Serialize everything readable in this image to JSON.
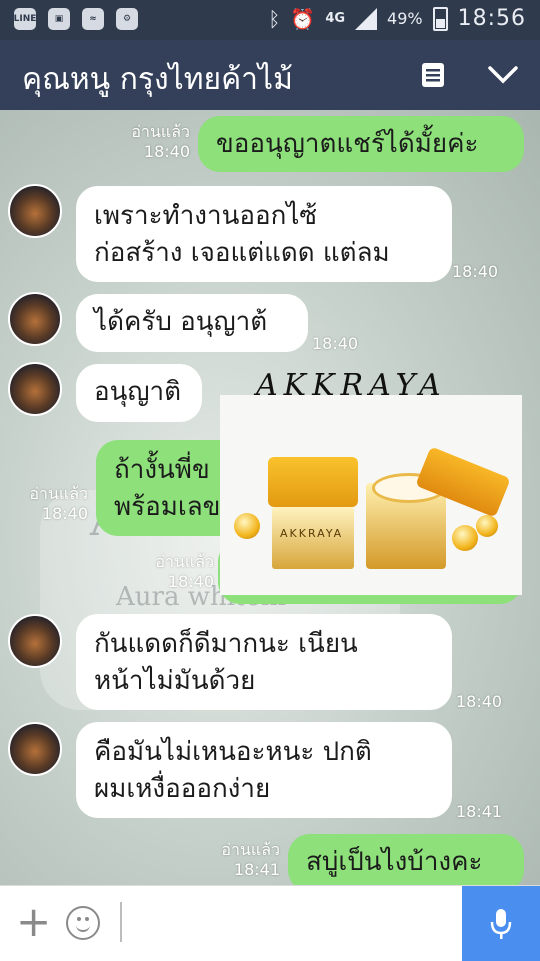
{
  "status_bar": {
    "icons_left": [
      "line-app-icon",
      "image-icon",
      "wifi-icon",
      "alarm-settings-icon"
    ],
    "line_label": "LINE",
    "network": "4G",
    "battery": "49%",
    "time": "18:56"
  },
  "header": {
    "title": "คุณหนู กรุงไทยค้าไม้"
  },
  "messages": [
    {
      "side": "out",
      "read": "อ่านแล้ว",
      "time": "18:40",
      "text": "ขออนุญาตแชร์ได้มั้ยค่ะ"
    },
    {
      "side": "in",
      "time": "18:40",
      "text": "เพราะทำงานออกไซ้\nก่อสร้าง เจอแต่แดด แต่ลม"
    },
    {
      "side": "in",
      "time": "18:40",
      "text": "ได้ครับ อนุญาต้"
    },
    {
      "side": "in",
      "time": "",
      "text": "อนุญาติ"
    },
    {
      "side": "out",
      "read": "อ่านแล้ว",
      "time": "18:40",
      "text": "ถ้างั้นพี่ข\nพร้อมเลข"
    },
    {
      "side": "out",
      "read": "อ่านแล้ว",
      "time": "18:40",
      "text": ""
    },
    {
      "side": "in",
      "time": "18:40",
      "text": "กันแดดก็ดีมากนะ เนียน\nหน้าไม่มันด้วย"
    },
    {
      "side": "in",
      "time": "18:41",
      "text": "คือมันไม่เหนอะหนะ ปกติ\nผมเหงื่อออกง่าย"
    },
    {
      "side": "out",
      "read": "อ่านแล้ว",
      "time": "18:41",
      "text": "สบู่เป็นไงบ้างคะ"
    }
  ],
  "background_text": {
    "brand": "AKKR",
    "product": "Aura whiteni"
  },
  "product_image": {
    "signature": "AKKRAYA",
    "jar_label": "AKKRAYA"
  },
  "input": {
    "placeholder": ""
  },
  "colors": {
    "outgoing": "#8de07a",
    "incoming": "#ffffff",
    "header": "#34405a",
    "mic": "#4a8ef0"
  }
}
